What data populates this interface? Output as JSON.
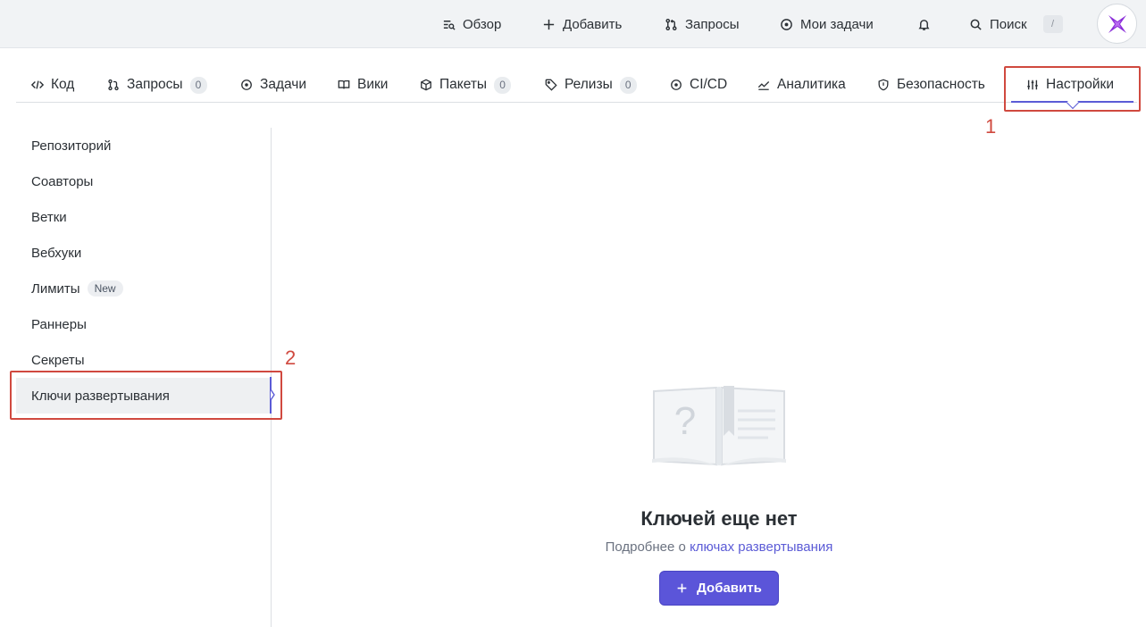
{
  "topnav": {
    "overview": "Обзор",
    "add": "Добавить",
    "requests": "Запросы",
    "my_tasks": "Мои задачи",
    "search": "Поиск",
    "search_shortcut": "/"
  },
  "tabs": {
    "code": "Код",
    "requests": "Запросы",
    "requests_count": "0",
    "tasks": "Задачи",
    "wiki": "Вики",
    "packages": "Пакеты",
    "packages_count": "0",
    "releases": "Релизы",
    "releases_count": "0",
    "cicd": "CI/CD",
    "analytics": "Аналитика",
    "security": "Безопасность",
    "settings": "Настройки"
  },
  "sidebar": {
    "items": [
      {
        "label": "Репозиторий"
      },
      {
        "label": "Соавторы"
      },
      {
        "label": "Ветки"
      },
      {
        "label": "Вебхуки"
      },
      {
        "label": "Лимиты",
        "badge": "New"
      },
      {
        "label": "Раннеры"
      },
      {
        "label": "Секреты"
      },
      {
        "label": "Ключи развертывания"
      }
    ]
  },
  "empty_state": {
    "title": "Ключей еще нет",
    "subtitle_prefix": "Подробнее о",
    "subtitle_link": "ключах развертывания",
    "button": "Добавить"
  },
  "annotations": {
    "first": "1",
    "second": "2"
  },
  "colors": {
    "accent": "#5b5bd6",
    "button": "#5b55d9",
    "callout": "#d0493f"
  }
}
